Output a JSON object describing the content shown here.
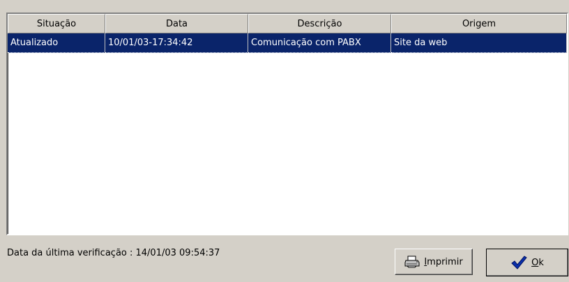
{
  "grid": {
    "columns": [
      "Situação",
      "Data",
      "Descrição",
      "Origem"
    ],
    "rows": [
      [
        "Atualizado",
        "10/01/03-17:34:42",
        "Comunicação com PABX",
        "Site da web"
      ]
    ]
  },
  "status": {
    "last_check": "Data da última verificação : 14/01/03 09:54:37"
  },
  "buttons": {
    "print_first": "I",
    "print_rest": "mprimir",
    "ok_first": "O",
    "ok_rest": "k"
  },
  "icons": {
    "print": "printer-icon",
    "ok": "checkmark-icon"
  },
  "colors": {
    "selection": "#0a246a",
    "face": "#d4d0c8",
    "check": "#0a2faa"
  }
}
